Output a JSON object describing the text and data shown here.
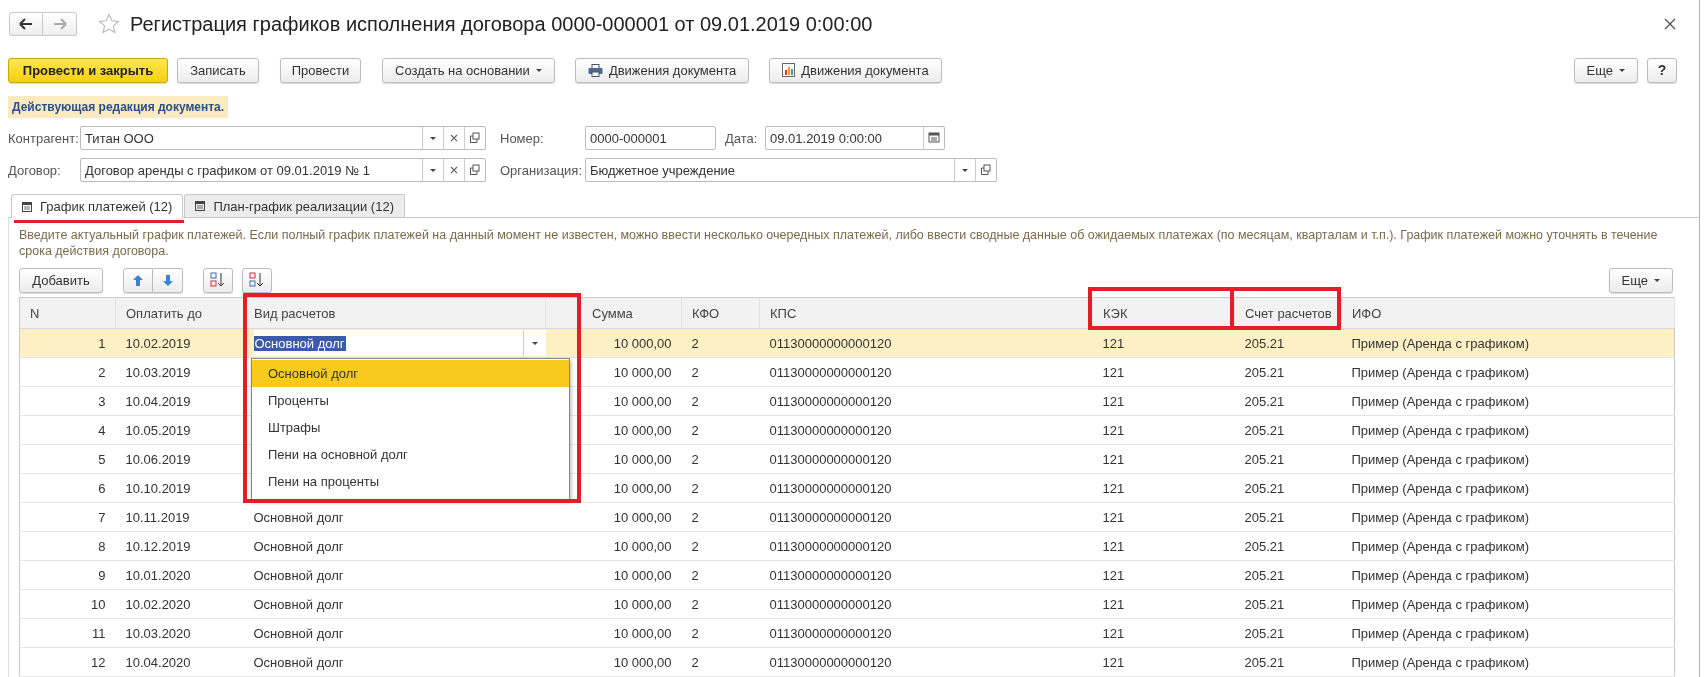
{
  "window": {
    "title": "Регистрация графиков исполнения договора 0000-000001 от 09.01.2019 0:00:00"
  },
  "nav": [
    {
      "kind": "back",
      "disabled": false
    },
    {
      "kind": "forward",
      "disabled": true
    }
  ],
  "toolbar": {
    "buttons": [
      {
        "label": "Провести и закрыть",
        "kind": "primary"
      },
      {
        "label": "Записать",
        "kind": "plain"
      },
      {
        "label": "Провести",
        "kind": "plain"
      },
      {
        "label": "Создать на основании",
        "kind": "menu"
      },
      {
        "label": "Движения документа",
        "kind": "print"
      },
      {
        "label": "Движения документа",
        "kind": "report"
      }
    ],
    "more": "Еще",
    "help": "?"
  },
  "banner": "Действующая редакция документа.",
  "form": {
    "counterparty": {
      "label": "Контрагент:",
      "value": "Титан ООО"
    },
    "number": {
      "label": "Номер:",
      "value": "0000-000001"
    },
    "date": {
      "label": "Дата:",
      "value": "09.01.2019  0:00:00"
    },
    "contract": {
      "label": "Договор:",
      "value": "Договор аренды с графиком от 09.01.2019 № 1"
    },
    "organization": {
      "label": "Организация:",
      "value": "Бюджетное учреждение"
    }
  },
  "tabs": [
    {
      "label": "График платежей (12)",
      "selected": true,
      "underlined": true
    },
    {
      "label": "План-график реализации (12)",
      "selected": false,
      "underlined": false
    }
  ],
  "hint": "Введите актуальный график платежей. Если полный график платежей на данный момент не известен, можно ввести несколько очередных платежей, либо ввести сводные данные об ожидаемых платежах (по месяцам, кварталам и т.п.). График платежей можно уточнять в течение срока действия договора.",
  "table_toolbar": {
    "add": "Добавить",
    "more": "Еще"
  },
  "table": {
    "columns": [
      {
        "title": "N",
        "highlighted": false
      },
      {
        "title": "Оплатить до",
        "highlighted": false
      },
      {
        "title": "Вид расчетов",
        "highlighted": false
      },
      {
        "title": "Сумма",
        "highlighted": false
      },
      {
        "title": "КФО",
        "highlighted": false
      },
      {
        "title": "КПС",
        "highlighted": false
      },
      {
        "title": "КЭК",
        "highlighted": true
      },
      {
        "title": "Счет расчетов",
        "highlighted": true
      },
      {
        "title": "ИФО",
        "highlighted": false
      }
    ],
    "rows": [
      {
        "cells": [
          "1",
          "10.02.2019",
          "Основной долг",
          "10 000,00",
          "2",
          "01130000000000120",
          "121",
          "205.21",
          "Пример (Аренда с графиком)"
        ],
        "selected": true,
        "editing": true
      },
      {
        "cells": [
          "2",
          "10.03.2019",
          null,
          "10 000,00",
          "2",
          "01130000000000120",
          "121",
          "205.21",
          "Пример (Аренда с графиком)"
        ],
        "selected": false,
        "editing": false
      },
      {
        "cells": [
          "3",
          "10.04.2019",
          null,
          "10 000,00",
          "2",
          "01130000000000120",
          "121",
          "205.21",
          "Пример (Аренда с графиком)"
        ],
        "selected": false,
        "editing": false
      },
      {
        "cells": [
          "4",
          "10.05.2019",
          null,
          "10 000,00",
          "2",
          "01130000000000120",
          "121",
          "205.21",
          "Пример (Аренда с графиком)"
        ],
        "selected": false,
        "editing": false
      },
      {
        "cells": [
          "5",
          "10.06.2019",
          null,
          "10 000,00",
          "2",
          "01130000000000120",
          "121",
          "205.21",
          "Пример (Аренда с графиком)"
        ],
        "selected": false,
        "editing": false
      },
      {
        "cells": [
          "6",
          "10.10.2019",
          null,
          "10 000,00",
          "2",
          "01130000000000120",
          "121",
          "205.21",
          "Пример (Аренда с графиком)"
        ],
        "selected": false,
        "editing": false
      },
      {
        "cells": [
          "7",
          "10.11.2019",
          "Основной долг",
          "10 000,00",
          "2",
          "01130000000000120",
          "121",
          "205.21",
          "Пример (Аренда с графиком)"
        ],
        "selected": false,
        "editing": false
      },
      {
        "cells": [
          "8",
          "10.12.2019",
          "Основной долг",
          "10 000,00",
          "2",
          "01130000000000120",
          "121",
          "205.21",
          "Пример (Аренда с графиком)"
        ],
        "selected": false,
        "editing": false
      },
      {
        "cells": [
          "9",
          "10.01.2020",
          "Основной долг",
          "10 000,00",
          "2",
          "01130000000000120",
          "121",
          "205.21",
          "Пример (Аренда с графиком)"
        ],
        "selected": false,
        "editing": false
      },
      {
        "cells": [
          "10",
          "10.02.2020",
          "Основной долг",
          "10 000,00",
          "2",
          "01130000000000120",
          "121",
          "205.21",
          "Пример (Аренда с графиком)"
        ],
        "selected": false,
        "editing": false
      },
      {
        "cells": [
          "11",
          "10.03.2020",
          "Основной долг",
          "10 000,00",
          "2",
          "01130000000000120",
          "121",
          "205.21",
          "Пример (Аренда с графиком)"
        ],
        "selected": false,
        "editing": false
      },
      {
        "cells": [
          "12",
          "10.04.2020",
          "Основной долг",
          "10 000,00",
          "2",
          "01130000000000120",
          "121",
          "205.21",
          "Пример (Аренда с графиком)"
        ],
        "selected": false,
        "editing": false
      }
    ]
  },
  "dropdown": {
    "highlighted": true,
    "options": [
      {
        "label": "Основной долг",
        "selected": true
      },
      {
        "label": "Проценты",
        "selected": false
      },
      {
        "label": "Штрафы",
        "selected": false
      },
      {
        "label": "Пени на основной долг",
        "selected": false
      },
      {
        "label": "Пени на проценты",
        "selected": false
      }
    ]
  }
}
